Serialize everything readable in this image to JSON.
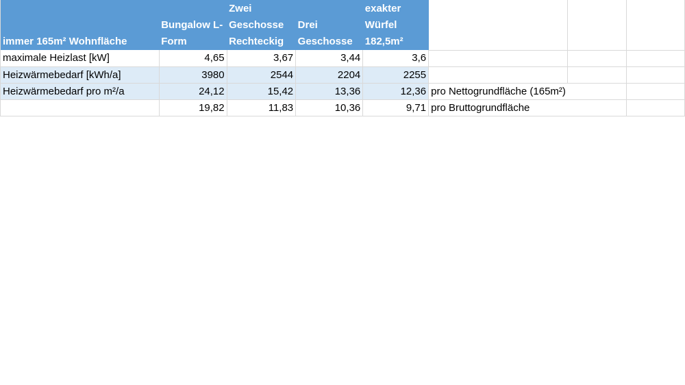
{
  "table": {
    "headers": [
      "immer 165m² Wohnfläche",
      "Bungalow L-Form",
      "Zwei Geschosse Rechteckig",
      "Drei Geschosse",
      "exakter Würfel 182,5m²"
    ],
    "rows": [
      {
        "label": "maximale Heizlast [kW]",
        "values": [
          "4,65",
          "3,67",
          "3,44",
          "3,6"
        ],
        "note": ""
      },
      {
        "label": "Heizwärmebedarf [kWh/a]",
        "values": [
          "3980",
          "2544",
          "2204",
          "2255"
        ],
        "note": ""
      },
      {
        "label": "Heizwärmebedarf pro m²/a",
        "values": [
          "24,12",
          "15,42",
          "13,36",
          "12,36"
        ],
        "note": "pro Nettogrundfläche (165m²)"
      },
      {
        "label": "",
        "values": [
          "19,82",
          "11,83",
          "10,36",
          "9,71"
        ],
        "note": "pro Bruttogrundfläche"
      }
    ]
  }
}
